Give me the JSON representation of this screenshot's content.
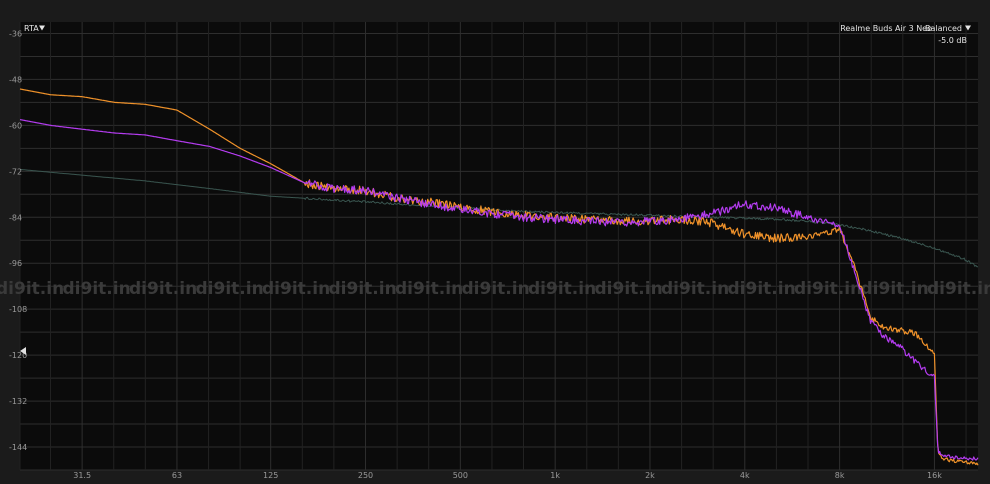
{
  "header": {
    "rta_label": "RTA",
    "device_label": "Realme Buds Air 3 Neo",
    "preset_label": "Balanced",
    "offset_label": "-5.0 dB"
  },
  "watermark": "di9it.in",
  "colors": {
    "background": "#0b0b0b",
    "grid": "#2e2e2e",
    "frame": "#1b1b1b",
    "series_orange": "#f0922a",
    "series_purple": "#b43cf0",
    "series_teal": "#3a5650"
  },
  "chart_data": {
    "type": "line",
    "x_scale": "log",
    "xlim": [
      20,
      22000
    ],
    "ylim": [
      -150,
      -33
    ],
    "grid": true,
    "y_ticks": [
      -36,
      -48,
      -60,
      -72,
      -84,
      -96,
      -108,
      -120,
      -132,
      -144
    ],
    "x_ticks": [
      {
        "value": 31.5,
        "label": "31.5"
      },
      {
        "value": 63,
        "label": "63"
      },
      {
        "value": 125,
        "label": "125"
      },
      {
        "value": 250,
        "label": "250"
      },
      {
        "value": 500,
        "label": "500"
      },
      {
        "value": 1000,
        "label": "1k"
      },
      {
        "value": 2000,
        "label": "2k"
      },
      {
        "value": 4000,
        "label": "4k"
      },
      {
        "value": 8000,
        "label": "8k"
      },
      {
        "value": 16000,
        "label": "16k"
      }
    ],
    "series": [
      {
        "color": "orange",
        "x": [
          20,
          25,
          31.5,
          40,
          50,
          63,
          80,
          100,
          125,
          160,
          200,
          250,
          315,
          400,
          500,
          630,
          800,
          1000,
          1250,
          1600,
          2000,
          2500,
          3150,
          4000,
          5000,
          6300,
          7000,
          8000,
          9000,
          10000,
          11000,
          12500,
          14000,
          15000,
          16000,
          16400,
          17000,
          18000,
          20000,
          22000
        ],
        "y": [
          -50.5,
          -52,
          -52.5,
          -54,
          -54.5,
          -56,
          -61,
          -66,
          -70,
          -75,
          -76.5,
          -77,
          -79,
          -80,
          -81.5,
          -82.5,
          -83.5,
          -84,
          -84.5,
          -85,
          -85,
          -84.5,
          -85.5,
          -88.5,
          -89.5,
          -89,
          -88.5,
          -87,
          -98,
          -110,
          -112.5,
          -113.5,
          -114.5,
          -117,
          -120,
          -145,
          -147,
          -147.5,
          -148,
          -148.5
        ]
      },
      {
        "color": "purple",
        "x": [
          20,
          25,
          31.5,
          40,
          50,
          63,
          80,
          100,
          125,
          160,
          200,
          250,
          315,
          400,
          500,
          630,
          800,
          1000,
          1250,
          1600,
          2000,
          2500,
          3150,
          4000,
          5000,
          6300,
          7000,
          8000,
          9000,
          10000,
          11000,
          12500,
          14000,
          15000,
          16000,
          16400,
          17000,
          18000,
          20000,
          22000
        ],
        "y": [
          -58.5,
          -60,
          -61,
          -62,
          -62.5,
          -64,
          -65.5,
          -68,
          -71,
          -75,
          -76.5,
          -77,
          -79,
          -80.5,
          -82,
          -83,
          -84,
          -84.5,
          -85,
          -85.5,
          -85,
          -84.5,
          -83,
          -80.5,
          -81.5,
          -84,
          -85,
          -86,
          -99,
          -111,
          -115,
          -118,
          -122,
          -124,
          -126,
          -145,
          -146,
          -146.5,
          -147,
          -147
        ]
      },
      {
        "color": "teal",
        "x": [
          20,
          31.5,
          50,
          80,
          125,
          200,
          315,
          500,
          800,
          1250,
          2000,
          3150,
          4000,
          5000,
          6300,
          8000,
          10000,
          12500,
          16000,
          20000,
          22000
        ],
        "y": [
          -71.5,
          -73,
          -74.5,
          -76.5,
          -78.5,
          -79.5,
          -80.5,
          -81.5,
          -82.5,
          -83,
          -83.5,
          -84,
          -84.2,
          -84.5,
          -85,
          -86,
          -87.5,
          -89.5,
          -92,
          -95,
          -97
        ]
      }
    ]
  }
}
